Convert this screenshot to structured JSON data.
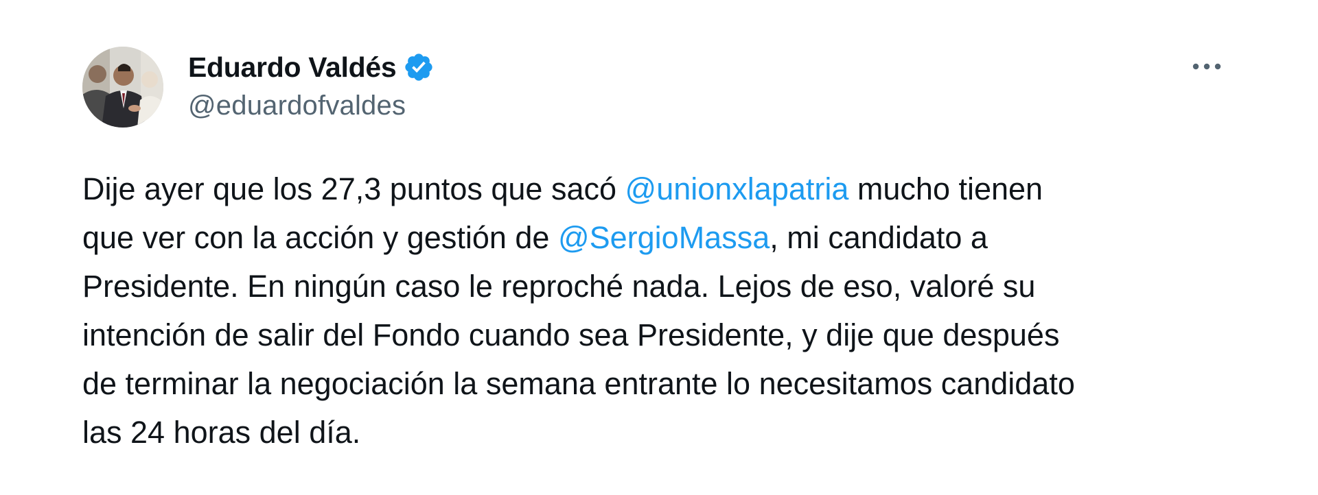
{
  "author": {
    "display_name": "Eduardo Valdés",
    "handle": "@eduardofvaldes",
    "verified": true,
    "verified_icon": "verified-badge-icon",
    "avatar": "profile-photo"
  },
  "menu_icon": "more-options-icon",
  "tweet": {
    "seg1": "Dije ayer que los 27,3 puntos que sacó ",
    "mention1": "@unionxlapatria",
    "seg2": " mucho tienen\nque ver con la acción y gestión de ",
    "mention2": "@SergioMassa",
    "seg3": ", mi candidato a\nPresidente. En ningún caso le reproché nada. Lejos de eso, valoré su\nintención de salir del Fondo cuando sea Presidente, y dije que después\nde terminar la negociación la semana entrante lo necesitamos candidato\nlas 24 horas del día."
  },
  "colors": {
    "text": "#0f1419",
    "secondary": "#536471",
    "link": "#1d9bf0",
    "verified": "#1d9bf0"
  }
}
